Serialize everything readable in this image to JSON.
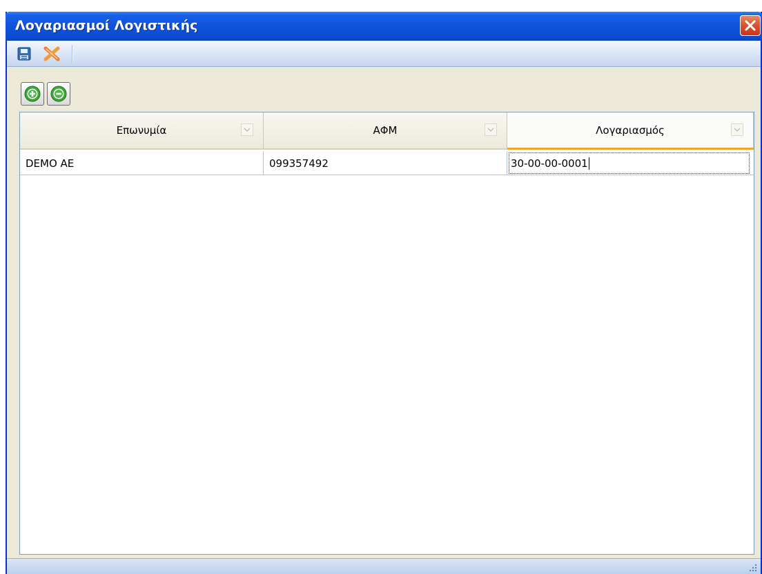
{
  "window": {
    "title": "Λογαριασμοί Λογιστικής"
  },
  "toolbar": {
    "save_icon": "save-icon",
    "cancel_icon": "cancel-icon"
  },
  "grid_actions": {
    "add_icon": "add-icon",
    "remove_icon": "remove-icon"
  },
  "grid": {
    "columns": [
      {
        "label": "Επωνυμία"
      },
      {
        "label": "ΑΦΜ"
      },
      {
        "label": "Λογαριασμός"
      }
    ],
    "rows": [
      {
        "name": "DEMO AE",
        "afm": "099357492",
        "account": "30-00-00-0001"
      }
    ]
  },
  "colors": {
    "titlebar": "#0b4cd0",
    "active_column_underline": "#f0a528"
  }
}
